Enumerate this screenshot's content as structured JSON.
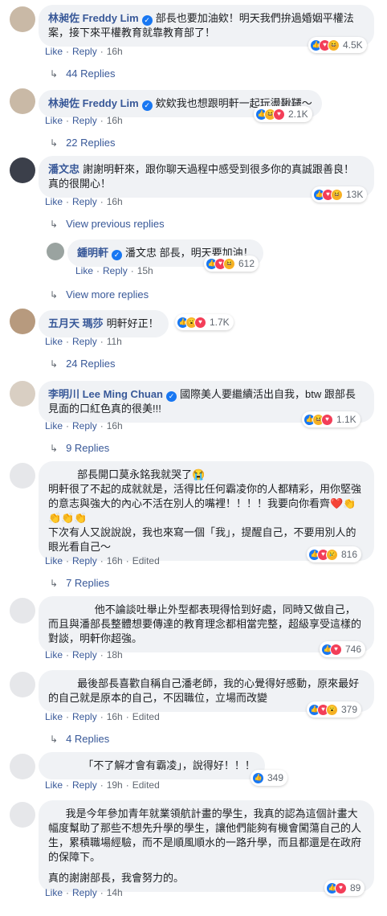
{
  "comments": [
    {
      "name": "林昶佐 Freddy Lim",
      "verified": true,
      "text": "部長也要加油欸！明天我們拚過婚姻平權法案，接下來平權教育就靠教育部了！",
      "like": "Like",
      "reply": "Reply",
      "time": "16h",
      "count": "4.5K",
      "replies": "44 Replies"
    },
    {
      "name": "林昶佐 Freddy Lim",
      "verified": true,
      "text": "欸欸我也想跟明軒一起玩盪鞦韆～",
      "like": "Like",
      "reply": "Reply",
      "time": "16h",
      "count": "2.1K",
      "replies": "22 Replies"
    },
    {
      "name": "潘文忠",
      "verified": false,
      "text": "謝謝明軒來，跟你聊天過程中感受到很多你的真誠跟善良！真的很開心！",
      "like": "Like",
      "reply": "Reply",
      "time": "16h",
      "count": "13K",
      "view_previous": "View previous replies"
    },
    {
      "name": "鍾明軒",
      "verified": true,
      "text": "潘文忠 部長，明天要加油！",
      "like": "Like",
      "reply": "Reply",
      "time": "15h",
      "count": "612",
      "view_more": "View more replies"
    },
    {
      "name": "五月天 瑪莎",
      "verified": false,
      "text": "明軒好正！",
      "like": "Like",
      "reply": "Reply",
      "time": "11h",
      "count": "1.7K",
      "replies": "24 Replies"
    },
    {
      "name": "李明川 Lee Ming Chuan",
      "verified": true,
      "text": "國際美人要繼續活出自我，btw 跟部長見面的口紅色真的很美!!!",
      "like": "Like",
      "reply": "Reply",
      "time": "16h",
      "count": "1.1K",
      "replies": "9 Replies"
    },
    {
      "text_line1": "部長開口莫永銘我就哭了😭",
      "text_rest": "明軒很了不起的成就就是，活得比任何霸凌你的人都精彩，用你堅強的意志與強大的內心不活在別人的嘴裡！！！！我要向你看齊❤️👏👏👏👏",
      "text_extra": "下次有人又說說說，我也來寫一個「我」，提醒自己，不要用別人的眼光看自己～",
      "like": "Like",
      "reply": "Reply",
      "time": "16h",
      "edited": "Edited",
      "count": "816",
      "replies": "7 Replies"
    },
    {
      "text": "他不論談吐舉止外型都表現得恰到好處，同時又做自己，而且與潘部長整體想要傳達的教育理念都相當完整，超級享受這樣的對談，明軒你超強。",
      "like": "Like",
      "reply": "Reply",
      "time": "18h",
      "count": "746"
    },
    {
      "text": "最後部長喜歡自稱自己潘老師，我的心覺得好感動，原來最好的自己就是原本的自己，不因職位，立場而改變",
      "like": "Like",
      "reply": "Reply",
      "time": "16h",
      "edited": "Edited",
      "count": "379",
      "replies": "4 Replies"
    },
    {
      "text": "「不了解才會有霸凌」，說得好！！！",
      "like": "Like",
      "reply": "Reply",
      "time": "19h",
      "edited": "Edited",
      "count": "349"
    },
    {
      "text": "我是今年參加青年就業領航計畫的學生，我真的認為這個計畫大幅度幫助了那些不想先升學的學生，讓他們能夠有機會闖蕩自己的人生，累積職場經驗，而不是順風順水的一路升學，而且都還是在政府的保障下。",
      "text2": "真的謝謝部長，我會努力的。",
      "like": "Like",
      "reply": "Reply",
      "time": "14h",
      "count": "89"
    }
  ],
  "colors": {
    "link": "#385898",
    "bubble": "#f0f2f5",
    "meta": "#606770",
    "like": "#1877f2",
    "love": "#f33e58"
  }
}
